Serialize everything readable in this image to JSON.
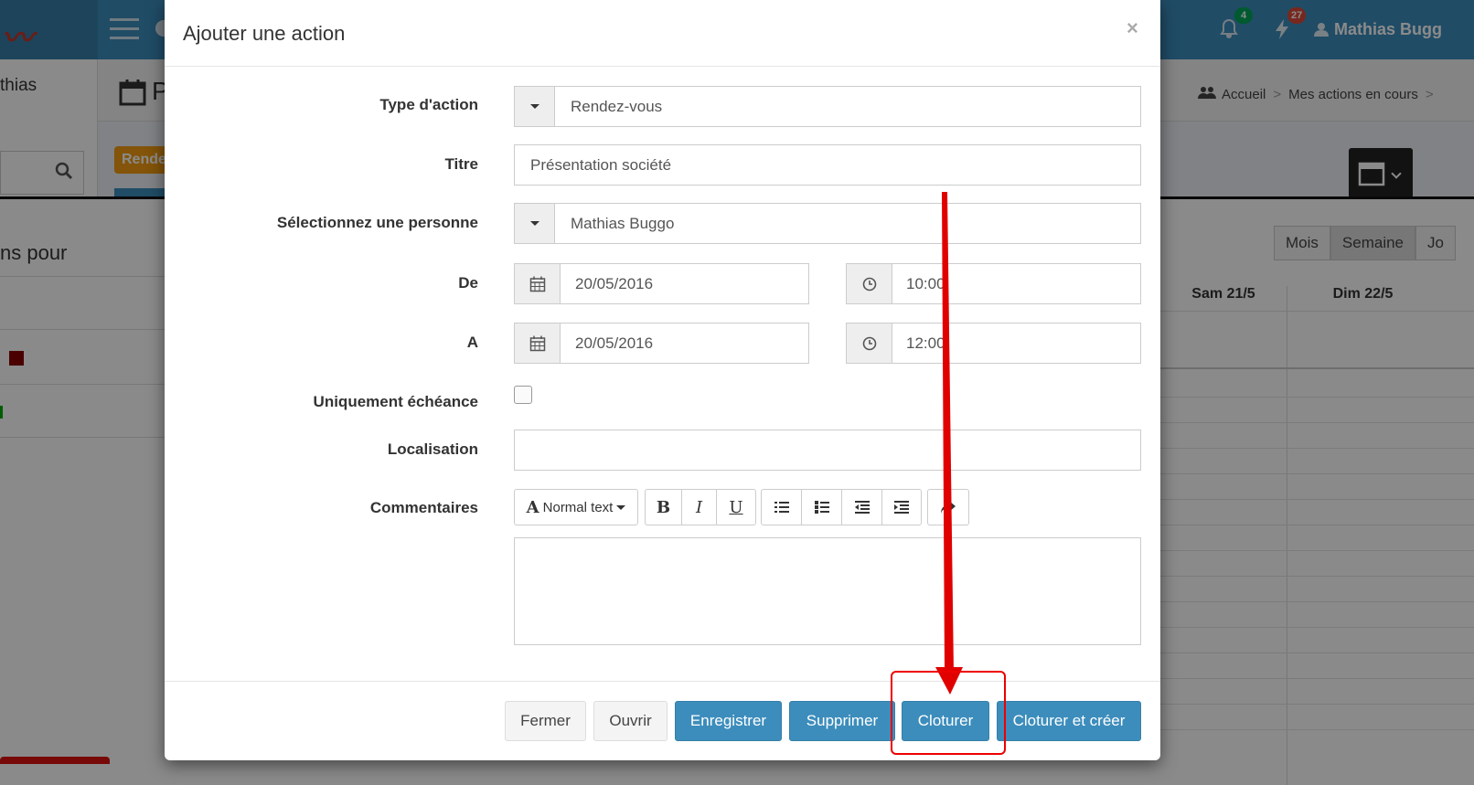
{
  "background": {
    "user_short": "thias",
    "notifications_count": "4",
    "alerts_count": "27",
    "user_name": "Mathias Bugg",
    "page_title_partial": "P",
    "breadcrumb": [
      "Accueil",
      "Mes actions en cours"
    ],
    "tag_label": "Rende",
    "section_partial": "ns pour",
    "view_buttons": [
      "Mois",
      "Semaine",
      "Jo"
    ],
    "day_headers": [
      "Sam 21/5",
      "Dim 22/5"
    ],
    "colors": {
      "brand": "#3c8dbc",
      "accent_orange": "#f39c12",
      "badge_green": "#00a65a",
      "badge_red": "#dd4b39"
    }
  },
  "modal": {
    "title": "Ajouter une action",
    "close_label": "×",
    "fields": {
      "type_label": "Type d'action",
      "type_value": "Rendez-vous",
      "title_label": "Titre",
      "title_value": "Présentation société",
      "person_label": "Sélectionnez une personne",
      "person_value": "Mathias Buggo",
      "from_label": "De",
      "from_date": "20/05/2016",
      "from_time": "10:00",
      "to_label": "A",
      "to_date": "20/05/2016",
      "to_time": "12:00",
      "deadline_label": "Uniquement échéance",
      "deadline_checked": false,
      "location_label": "Localisation",
      "location_value": "",
      "comments_label": "Commentaires"
    },
    "editor_toolbar": {
      "style_select": "Normal text",
      "bold": "B",
      "italic": "I",
      "underline": "U"
    },
    "buttons": {
      "close": "Fermer",
      "open": "Ouvrir",
      "save": "Enregistrer",
      "delete": "Supprimer",
      "finish": "Cloturer",
      "finish_and_create": "Cloturer et créer"
    }
  },
  "annotation": {
    "arrow_color": "#e00000"
  }
}
